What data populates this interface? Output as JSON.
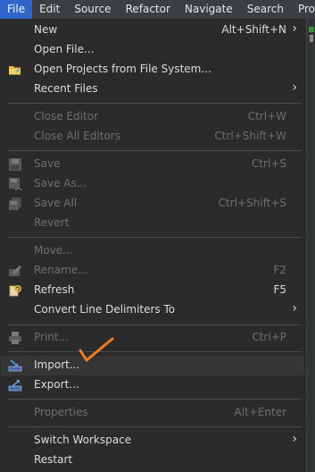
{
  "menubar": {
    "items": [
      "File",
      "Edit",
      "Source",
      "Refactor",
      "Navigate",
      "Search",
      "Pro"
    ]
  },
  "menu": {
    "new": {
      "label": "New",
      "shortcut": "Alt+Shift+N"
    },
    "open_file": {
      "label": "Open File..."
    },
    "open_projects": {
      "label": "Open Projects from File System..."
    },
    "recent_files": {
      "label": "Recent Files"
    },
    "close_editor": {
      "label": "Close Editor",
      "shortcut": "Ctrl+W"
    },
    "close_all_editors": {
      "label": "Close All Editors",
      "shortcut": "Ctrl+Shift+W"
    },
    "save": {
      "label": "Save",
      "shortcut": "Ctrl+S"
    },
    "save_as": {
      "label": "Save As..."
    },
    "save_all": {
      "label": "Save All",
      "shortcut": "Ctrl+Shift+S"
    },
    "revert": {
      "label": "Revert"
    },
    "move": {
      "label": "Move..."
    },
    "rename": {
      "label": "Rename...",
      "shortcut": "F2"
    },
    "refresh": {
      "label": "Refresh",
      "shortcut": "F5"
    },
    "convert_line_delimiters": {
      "label": "Convert Line Delimiters To"
    },
    "print": {
      "label": "Print...",
      "shortcut": "Ctrl+P"
    },
    "import": {
      "label": "Import..."
    },
    "export": {
      "label": "Export..."
    },
    "properties": {
      "label": "Properties",
      "shortcut": "Alt+Enter"
    },
    "switch_workspace": {
      "label": "Switch Workspace"
    },
    "restart": {
      "label": "Restart"
    }
  },
  "submenu_arrow": "›",
  "colors": {
    "menu_bg": "#2b2b2b",
    "menubar_bg": "#3c3f41",
    "active_menu": "#2f65ca",
    "annotation": "#f07c22"
  },
  "icons": {
    "open_projects": "folder-icon",
    "save": "save-icon",
    "save_as": "save-as-icon",
    "save_all": "save-all-icon",
    "rename": "rename-icon",
    "refresh": "refresh-icon",
    "print": "printer-icon",
    "import": "import-icon",
    "export": "export-icon"
  }
}
